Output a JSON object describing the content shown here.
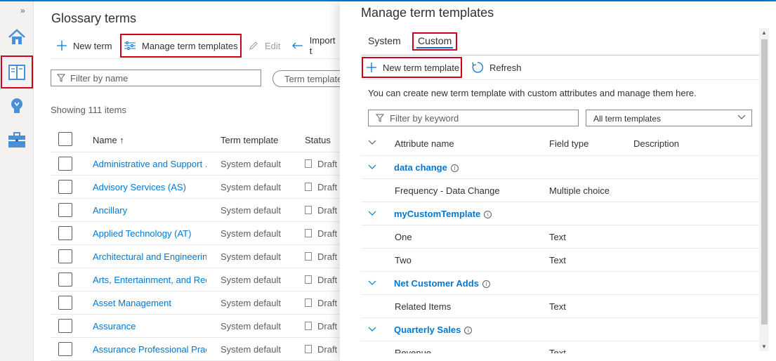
{
  "rail": {
    "expand_label": "»",
    "items": [
      {
        "icon": "home-icon"
      },
      {
        "icon": "glossary-book-icon",
        "selected": true
      },
      {
        "icon": "insights-bulb-icon"
      },
      {
        "icon": "management-toolbox-icon"
      }
    ]
  },
  "glossary": {
    "title": "Glossary terms",
    "toolbar": {
      "new_term": "New term",
      "manage_templates": "Manage term templates",
      "edit": "Edit",
      "import": "Import t"
    },
    "filter_placeholder": "Filter by name",
    "template_filter": "Term template",
    "showing": "Showing 111 items",
    "columns": {
      "name": "Name ↑",
      "template": "Term template",
      "status": "Status"
    },
    "rows": [
      {
        "name": "Administrative and Support ...",
        "template": "System default",
        "status": "Draft"
      },
      {
        "name": "Advisory Services (AS)",
        "template": "System default",
        "status": "Draft"
      },
      {
        "name": "Ancillary",
        "template": "System default",
        "status": "Draft"
      },
      {
        "name": "Applied Technology (AT)",
        "template": "System default",
        "status": "Draft"
      },
      {
        "name": "Architectural and Engineering",
        "template": "System default",
        "status": "Draft"
      },
      {
        "name": "Arts, Entertainment, and Rec",
        "template": "System default",
        "status": "Draft"
      },
      {
        "name": "Asset Management",
        "template": "System default",
        "status": "Draft"
      },
      {
        "name": "Assurance",
        "template": "System default",
        "status": "Draft"
      },
      {
        "name": "Assurance Professional Pract",
        "template": "System default",
        "status": "Draft"
      }
    ]
  },
  "panel": {
    "title": "Manage term templates",
    "tabs": {
      "system": "System",
      "custom": "Custom"
    },
    "toolbar": {
      "new_template": "New term template",
      "refresh": "Refresh"
    },
    "hint": "You can create new term template with custom attributes and manage them here.",
    "keyword_placeholder": "Filter by keyword",
    "template_select": "All term templates",
    "columns": {
      "attribute": "Attribute name",
      "field_type": "Field type",
      "description": "Description"
    },
    "groups": [
      {
        "name": "data change",
        "attributes": [
          {
            "name": "Frequency - Data Change",
            "type": "Multiple choice"
          }
        ]
      },
      {
        "name": "myCustomTemplate",
        "attributes": [
          {
            "name": "One",
            "type": "Text"
          },
          {
            "name": "Two",
            "type": "Text"
          }
        ]
      },
      {
        "name": "Net Customer Adds",
        "attributes": [
          {
            "name": "Related Items",
            "type": "Text"
          }
        ]
      },
      {
        "name": "Quarterly Sales",
        "attributes": [
          {
            "name": "Revenue",
            "type": "Text"
          }
        ]
      }
    ]
  },
  "colors": {
    "accent": "#0078d4",
    "highlight_box": "#d0021b"
  }
}
